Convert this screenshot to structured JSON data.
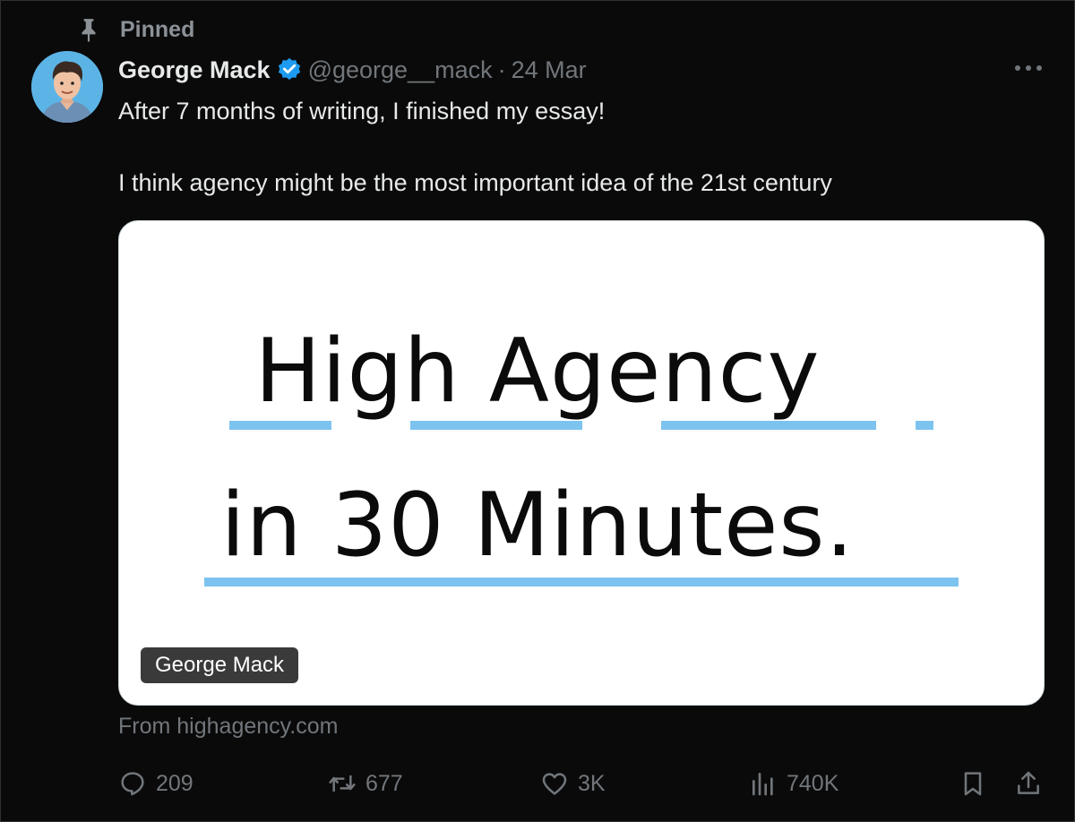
{
  "pinned_label": "Pinned",
  "author": {
    "name": "George Mack",
    "handle": "@george__mack",
    "separator": "·",
    "date": "24 Mar"
  },
  "tweet": {
    "line1": "After 7 months of writing, I finished my essay!",
    "line2": "I think agency might be the most important idea of the 21st century"
  },
  "card": {
    "title_line1": "High Agency",
    "title_line2": "in 30 Minutes.",
    "badge": "George Mack",
    "source": "From highagency.com"
  },
  "actions": {
    "replies": "209",
    "reposts": "677",
    "likes": "3K",
    "views": "740K"
  },
  "colors": {
    "accent": "#1d9bf0",
    "underline": "#7cc3ef",
    "muted": "#71767b"
  },
  "icons": [
    "pin-icon",
    "verified-badge-icon",
    "more-icon",
    "reply-icon",
    "repost-icon",
    "like-icon",
    "views-icon",
    "bookmark-icon",
    "share-icon"
  ]
}
